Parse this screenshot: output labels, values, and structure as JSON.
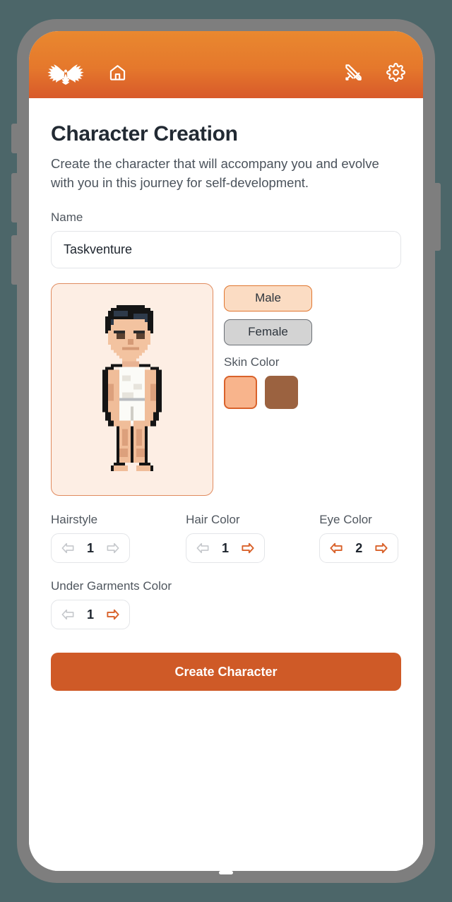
{
  "header": {
    "logo_icon": "phoenix-logo-icon",
    "home_icon": "home-icon",
    "battle_icon": "crossed-swords-icon",
    "settings_icon": "gear-icon",
    "gradient_top": "#e9882f",
    "gradient_bottom": "#d8592a"
  },
  "page": {
    "title": "Character Creation",
    "subtitle": "Create the character that will accompany you and evolve with you in this journey for self-development."
  },
  "name_field": {
    "label": "Name",
    "value": "Taskventure",
    "placeholder": "Name"
  },
  "gender": {
    "options": [
      {
        "label": "Male",
        "selected": true
      },
      {
        "label": "Female",
        "selected": false
      }
    ]
  },
  "skin_color": {
    "label": "Skin Color",
    "swatches": [
      {
        "color": "#f8b48c",
        "selected": true
      },
      {
        "color": "#9b6240",
        "selected": false
      }
    ]
  },
  "steppers": [
    {
      "label": "Hairstyle",
      "value": "1",
      "prev_enabled": false,
      "next_enabled": false
    },
    {
      "label": "Hair Color",
      "value": "1",
      "prev_enabled": false,
      "next_enabled": true
    },
    {
      "label": "Eye Color",
      "value": "2",
      "prev_enabled": true,
      "next_enabled": true
    },
    {
      "label": "Under Garments Color",
      "value": "1",
      "prev_enabled": false,
      "next_enabled": true
    }
  ],
  "create_button": {
    "label": "Create Character",
    "color": "#cf5a27"
  },
  "theme": {
    "page_background": "#4c6669",
    "phone_frame": "#7e7e7e",
    "accent": "#d9622b",
    "preview_background": "#fdeee4",
    "preview_border": "#e08b5f"
  }
}
